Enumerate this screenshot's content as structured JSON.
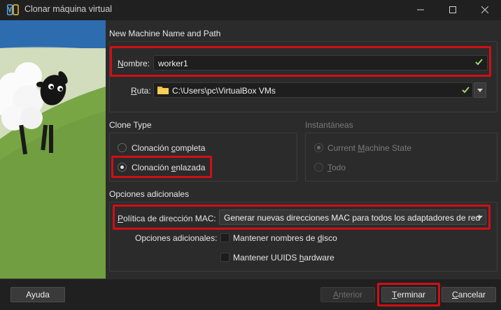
{
  "window": {
    "title": "Clonar máquina virtual"
  },
  "name_path": {
    "section_title": "New Machine Name and Path",
    "name_label_u": "N",
    "name_label_rest": "ombre:",
    "name_value": "worker1",
    "path_label_u": "R",
    "path_label_rest": "uta:",
    "path_value": "C:\\Users\\pc\\VirtualBox VMs"
  },
  "clone_type": {
    "section_title": "Clone Type",
    "full_pre": "Clonación ",
    "full_u": "c",
    "full_post": "ompleta",
    "linked_pre": "Clonación ",
    "linked_u": "e",
    "linked_post": "nlazada",
    "selected": "linked"
  },
  "snapshots": {
    "section_title": "Instantáneas",
    "current_pre": "Current ",
    "current_u": "M",
    "current_post": "achine State",
    "all_u": "T",
    "all_post": "odo"
  },
  "additional": {
    "section_title": "Opciones adicionales",
    "mac_label_u": "P",
    "mac_label_rest": "olítica de dirección MAC:",
    "mac_value": "Generar nuevas direcciones MAC para todos los adaptadores de red",
    "options_label": "Opciones adicionales:",
    "keep_disk_pre": "Mantener nombres de ",
    "keep_disk_u": "d",
    "keep_disk_post": "isco",
    "keep_uuid_pre": "Mantener UUIDS ",
    "keep_uuid_u": "h",
    "keep_uuid_post": "ardware"
  },
  "buttons": {
    "help": "Ayuda",
    "back_u": "A",
    "back_rest": "nterior",
    "finish_u": "T",
    "finish_rest": "erminar",
    "cancel_u": "C",
    "cancel_rest": "ancelar"
  },
  "colors": {
    "highlight": "#d10f15",
    "valid_check": "#9bd36b",
    "folder": "#f0c040"
  }
}
